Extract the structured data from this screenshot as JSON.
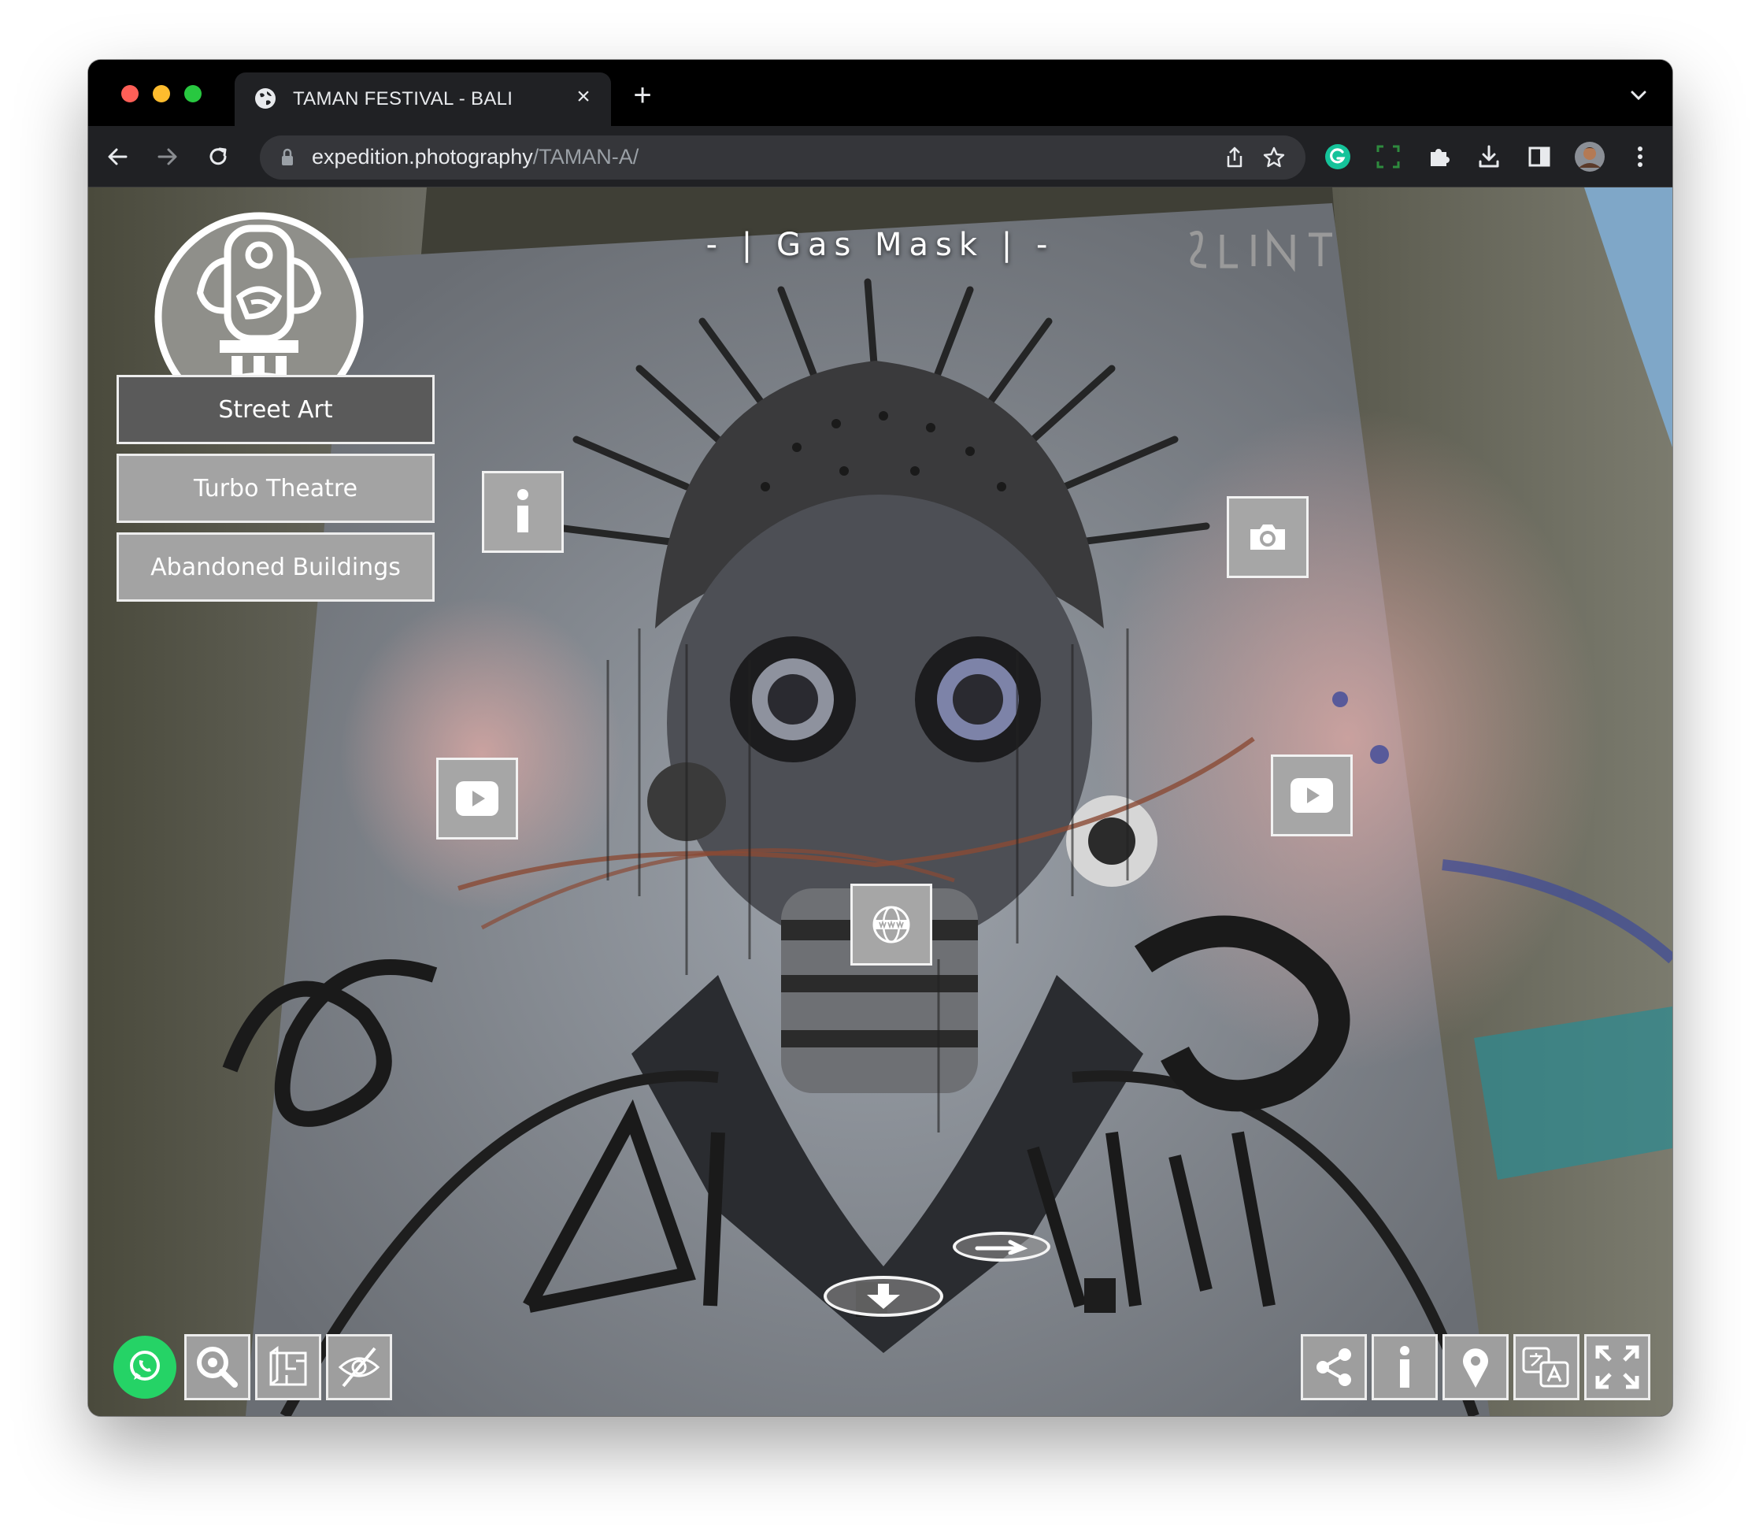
{
  "browser": {
    "tab_title": "TAMAN FESTIVAL - BALI",
    "close_glyph": "×",
    "new_tab_glyph": "+",
    "url_domain": "expedition.photography",
    "url_path": "/TAMAN-A/"
  },
  "page": {
    "title": "- | Gas Mask | -",
    "menu": [
      {
        "label": "Street Art",
        "active": true
      },
      {
        "label": "Turbo Theatre",
        "active": false
      },
      {
        "label": "Abandoned Buildings",
        "active": false
      }
    ],
    "hotspots": [
      "info-icon",
      "camera-icon",
      "video-play-icon",
      "video-play-icon",
      "web-globe-icon"
    ],
    "nav_arrows": [
      "arrow-right-icon",
      "arrow-down-icon"
    ],
    "controls_left": [
      "whatsapp-icon",
      "search-zoom-icon",
      "floorplan-icon",
      "hide-eye-icon"
    ],
    "controls_right": [
      "share-icon",
      "info-icon",
      "location-pin-icon",
      "translate-icon",
      "fullscreen-icon"
    ]
  },
  "colors": {
    "active_menu": "#5a5a5a",
    "inactive_menu": "#a3a3a3",
    "hotspot": "#a6a6a6",
    "whatsapp": "#25d366",
    "grammarly": "#15c39a"
  }
}
